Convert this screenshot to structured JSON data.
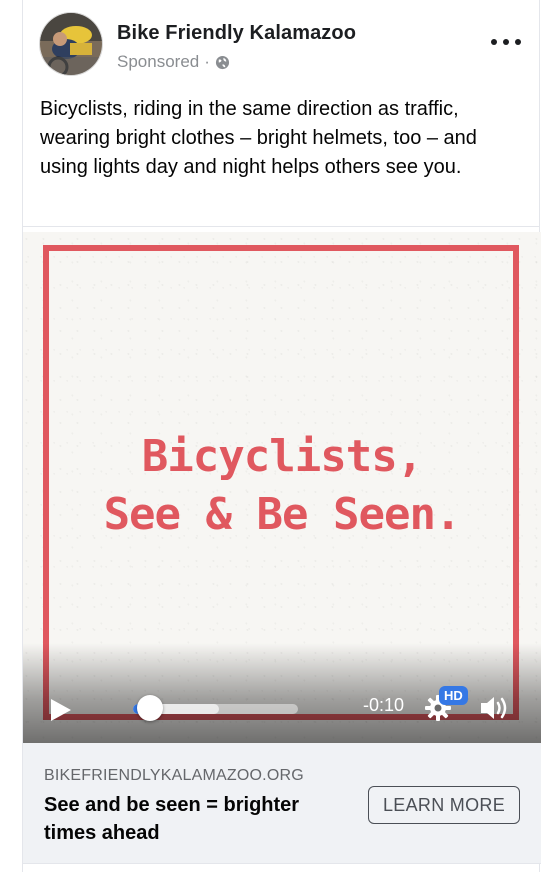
{
  "post": {
    "page_name": "Bike Friendly Kalamazoo",
    "sponsored_label": "Sponsored",
    "separator": "·",
    "privacy_icon": "globe-icon",
    "menu_icon": "more-options-icon",
    "caption": "Bicyclists, riding in the same direction as traffic, wearing bright clothes – bright helmets, too – and using lights day and night helps others see you."
  },
  "video": {
    "headline_line1": "Bicyclists,",
    "headline_line2": "See & Be Seen.",
    "time_remaining": "-0:10",
    "quality_badge": "HD",
    "progress_fraction": 0.1,
    "buffered_fraction": 0.52,
    "controls": {
      "play_icon": "play-icon",
      "settings_icon": "gear-icon",
      "volume_icon": "speaker-icon"
    }
  },
  "link_preview": {
    "domain": "BIKEFRIENDLYKALAMAZOO.ORG",
    "title": "See and be seen = brighter times ahead",
    "button_label": "LEARN MORE"
  },
  "colors": {
    "accent_red": "#e0585f",
    "progress_blue": "#3578e5",
    "panel_bg": "#f0f2f5"
  }
}
